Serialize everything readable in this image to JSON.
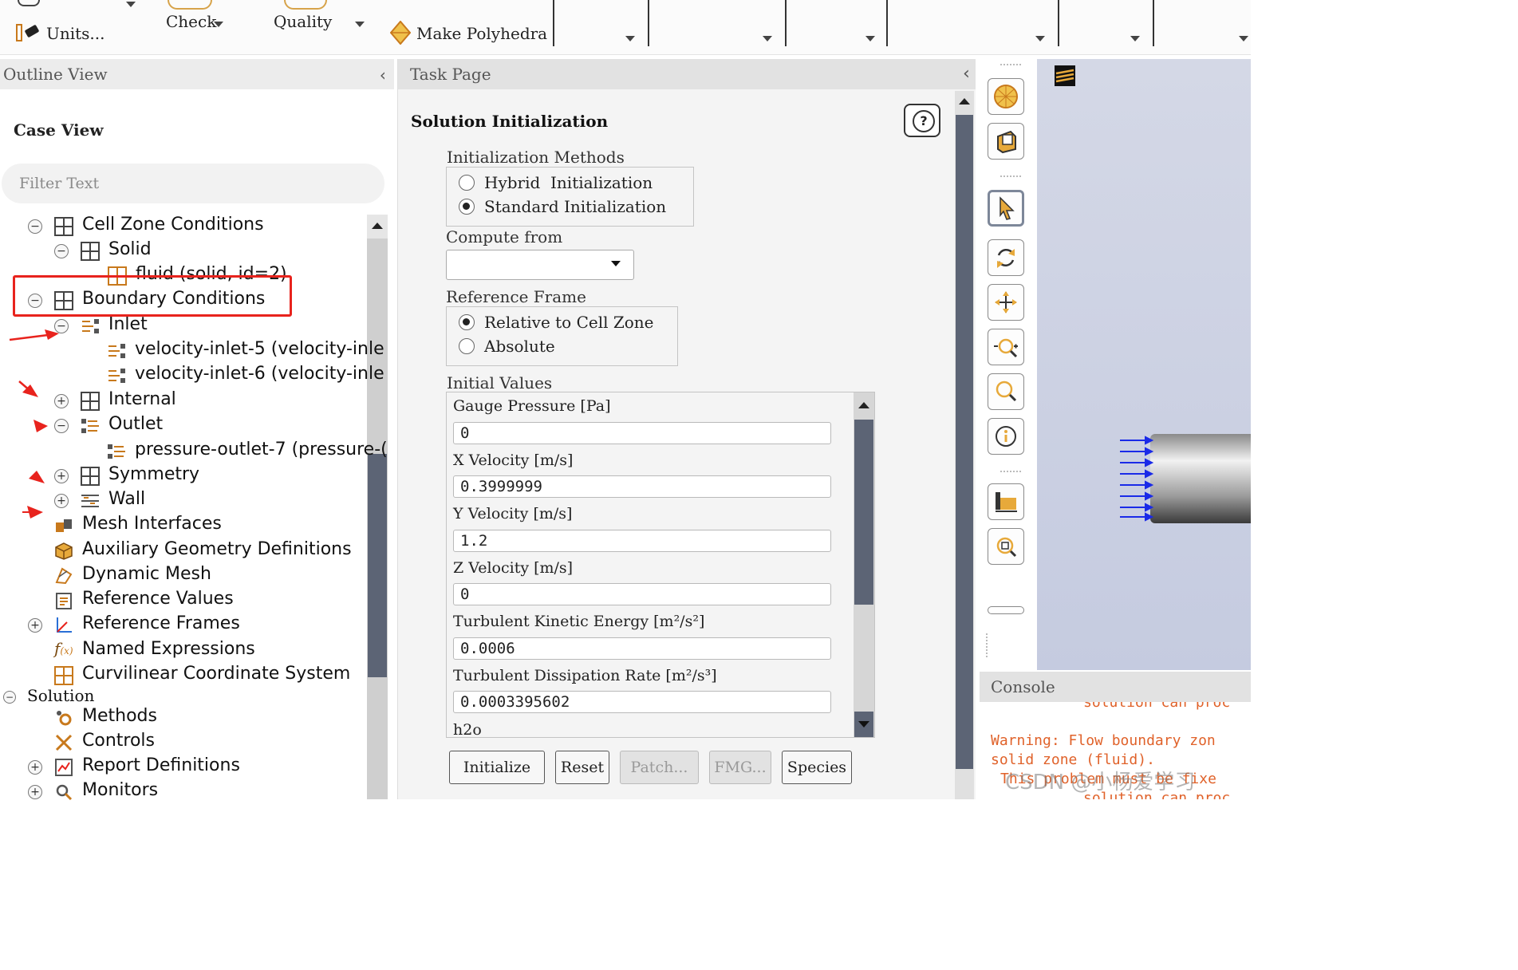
{
  "ribbon": {
    "units_label": "Units...",
    "check_label": "Check",
    "quality_label": "Quality",
    "make_polyhedra_label": "Make Polyhedra"
  },
  "outline": {
    "title": "Outline View",
    "case_view": "Case View",
    "filter_placeholder": "Filter Text",
    "items": {
      "cell_zone_conditions": "Cell Zone Conditions",
      "solid": "Solid",
      "fluid": "fluid (solid, id=2)",
      "boundary_conditions": "Boundary Conditions",
      "inlet": "Inlet",
      "velocity_inlet_5": "velocity-inlet-5 (velocity-inle",
      "velocity_inlet_6": "velocity-inlet-6 (velocity-inle",
      "internal": "Internal",
      "outlet": "Outlet",
      "pressure_outlet_7": "pressure-outlet-7 (pressure-(",
      "symmetry": "Symmetry",
      "wall": "Wall",
      "mesh_interfaces": "Mesh Interfaces",
      "auxiliary_geometry": "Auxiliary Geometry Definitions",
      "dynamic_mesh": "Dynamic Mesh",
      "reference_values": "Reference Values",
      "reference_frames": "Reference Frames",
      "named_expressions": "Named Expressions",
      "curvilinear": "Curvilinear Coordinate System",
      "solution": "Solution",
      "methods": "Methods",
      "controls": "Controls",
      "report_definitions": "Report Definitions",
      "monitors": "Monitors"
    }
  },
  "task_page": {
    "title": "Task Page",
    "heading": "Solution Initialization",
    "init_methods_label": "Initialization Methods",
    "hybrid_label": "Hybrid  Initialization",
    "standard_label": "Standard Initialization",
    "compute_from_label": "Compute from",
    "compute_from_value": "",
    "reference_frame_label": "Reference Frame",
    "relative_label": "Relative to Cell Zone",
    "absolute_label": "Absolute",
    "initial_values_label": "Initial Values",
    "fields": {
      "gauge_pressure_label": "Gauge Pressure [Pa]",
      "gauge_pressure_value": "0",
      "x_velocity_label": "X Velocity [m/s]",
      "x_velocity_value": "0.3999999",
      "y_velocity_label": "Y Velocity [m/s]",
      "y_velocity_value": "1.2",
      "z_velocity_label": "Z Velocity [m/s]",
      "z_velocity_value": "0",
      "tke_label": "Turbulent Kinetic Energy [m²/s²]",
      "tke_value": "0.0006",
      "tdr_label": "Turbulent Dissipation Rate [m²/s³]",
      "tdr_value": "0.0003395602",
      "h2o_label": "h2o"
    },
    "buttons": {
      "initialize": "Initialize",
      "reset": "Reset",
      "patch": "Patch...",
      "fmg": "FMG...",
      "species": "Species"
    }
  },
  "console": {
    "title": "Console",
    "line1": "solution can proc",
    "line2": "Warning: Flow boundary zon",
    "line3": "solid zone (fluid).",
    "line4": "This problem must be fixe",
    "line5": "solution can proc",
    "watermark": "CSDN @小杨爱学习"
  },
  "colors": {
    "highlight_box": "#e8231d",
    "arrow": "#e8231d",
    "accent_orange": "#c8791c",
    "console_text": "#e0622a",
    "scroll_thumb": "#5c6475"
  }
}
